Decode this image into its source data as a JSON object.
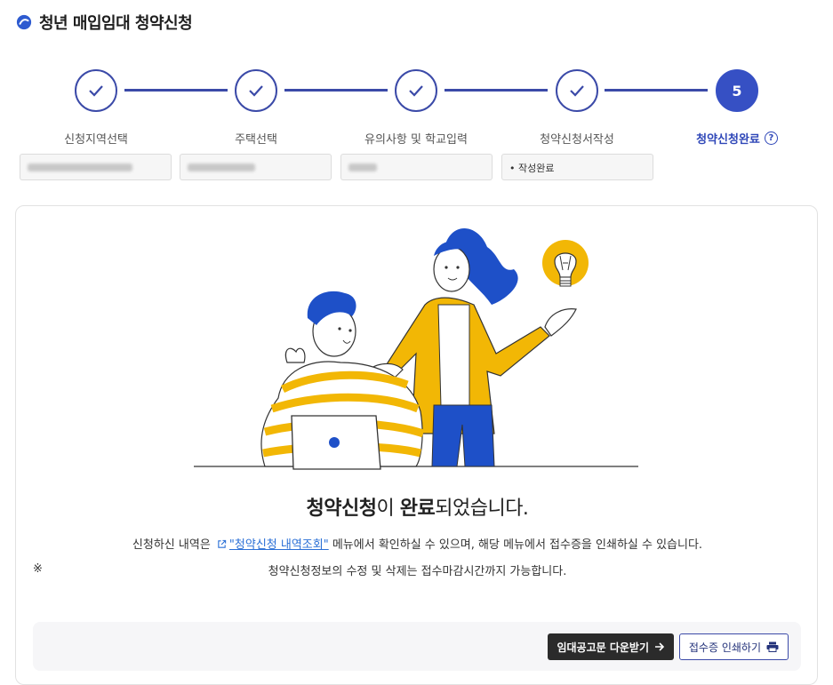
{
  "page": {
    "title": "청년 매입임대 청약신청"
  },
  "stepper": {
    "steps": [
      {
        "label": "신청지역선택",
        "status": "done",
        "field_value": ""
      },
      {
        "label": "주택선택",
        "status": "done",
        "field_value": ""
      },
      {
        "label": "유의사항 및 학교입력",
        "status": "done",
        "field_value": ""
      },
      {
        "label": "청약신청서작성",
        "status": "done",
        "field_value": "• 작성완료"
      },
      {
        "label": "청약신청완료",
        "status": "active",
        "number": "5"
      }
    ],
    "accent_color": "#3b4aa8"
  },
  "result": {
    "headline_part1": "청약신청",
    "headline_part2": "이 ",
    "headline_part3": "완료",
    "headline_part4": "되었습니다.",
    "info_prefix": "신청하신 내역은",
    "info_link": "\"청약신청 내역조회\"",
    "info_suffix": "메뉴에서 확인하실 수 있으며, 해당 메뉴에서 접수증을 인쇄하실 수 있습니다.",
    "note_mark": "※",
    "note_text": "청약신청정보의 수정 및 삭제는 접수마감시간까지 가능합니다."
  },
  "actions": {
    "download_label": "임대공고문 다운받기",
    "print_label": "접수증 인쇄하기"
  }
}
